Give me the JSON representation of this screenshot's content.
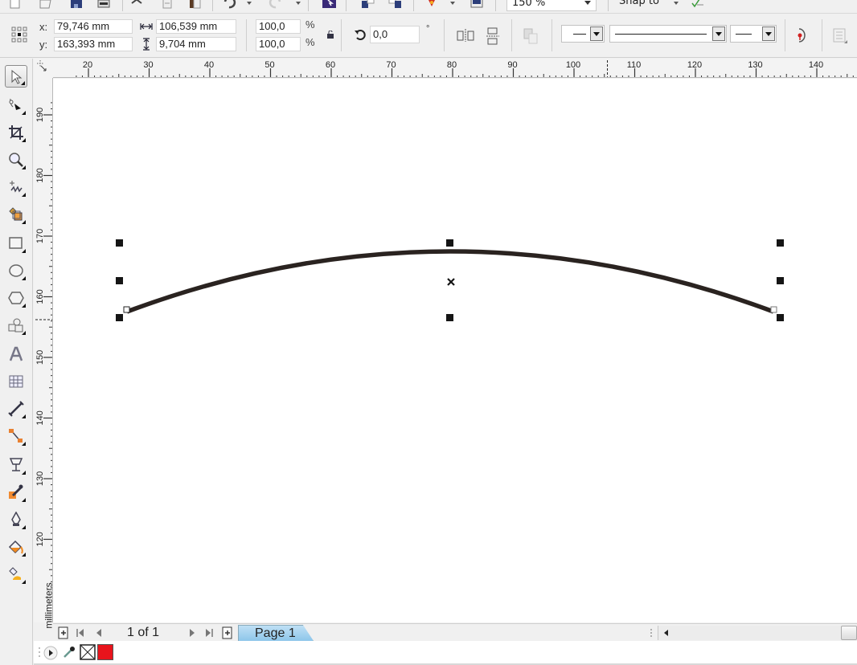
{
  "standard_toolbar": {
    "icons": [
      "new-document-icon",
      "open-icon",
      "save-icon",
      "print-icon",
      "cut-icon",
      "copy-icon",
      "paste-icon",
      "undo-icon",
      "redo-icon",
      "search-content-icon",
      "import-icon",
      "export-icon",
      "publish-pdf-icon",
      "application-launcher-icon"
    ],
    "zoom_level": "150 %",
    "snap_to_label": "Snap to"
  },
  "property_bar": {
    "x_label": "x:",
    "y_label": "y:",
    "x_value": "79,746 mm",
    "y_value": "163,393 mm",
    "width_value": "106,539 mm",
    "height_value": "9,704 mm",
    "scale_x": "100,0",
    "scale_y": "100,0",
    "percent_symbol": "%",
    "rotation_value": "0,0",
    "degree_symbol": "°"
  },
  "toolbox": {
    "tools": [
      {
        "name": "pick-tool",
        "active": true
      },
      {
        "name": "shape-tool"
      },
      {
        "name": "crop-tool"
      },
      {
        "name": "zoom-tool"
      },
      {
        "name": "freehand-tool"
      },
      {
        "name": "smart-fill-tool"
      },
      {
        "name": "rectangle-tool"
      },
      {
        "name": "ellipse-tool"
      },
      {
        "name": "polygon-tool"
      },
      {
        "name": "basic-shapes-tool"
      },
      {
        "name": "text-tool"
      },
      {
        "name": "table-tool"
      },
      {
        "name": "parallel-dimension-tool"
      },
      {
        "name": "connector-tool"
      },
      {
        "name": "blend-tool"
      },
      {
        "name": "color-eyedropper-tool"
      },
      {
        "name": "outline-pen-tool"
      },
      {
        "name": "fill-tool"
      },
      {
        "name": "interactive-fill-tool"
      }
    ]
  },
  "rulers": {
    "horizontal_labels": [
      "20",
      "30",
      "40",
      "50",
      "60",
      "70",
      "80",
      "90",
      "100",
      "110",
      "120",
      "130",
      "140"
    ],
    "vertical_labels": [
      "190",
      "180",
      "170",
      "160",
      "150",
      "140",
      "130",
      "120"
    ],
    "unit_label": "millimeters"
  },
  "page_nav": {
    "page_counter": "1 of 1",
    "page_tab_label": "Page 1"
  },
  "color_bar": {
    "fill_color": "#e8141c",
    "outline_none": true
  },
  "colors": {
    "curve_stroke": "#2a2320",
    "handle": "#151515",
    "page_tab": "#a8d4f0"
  }
}
